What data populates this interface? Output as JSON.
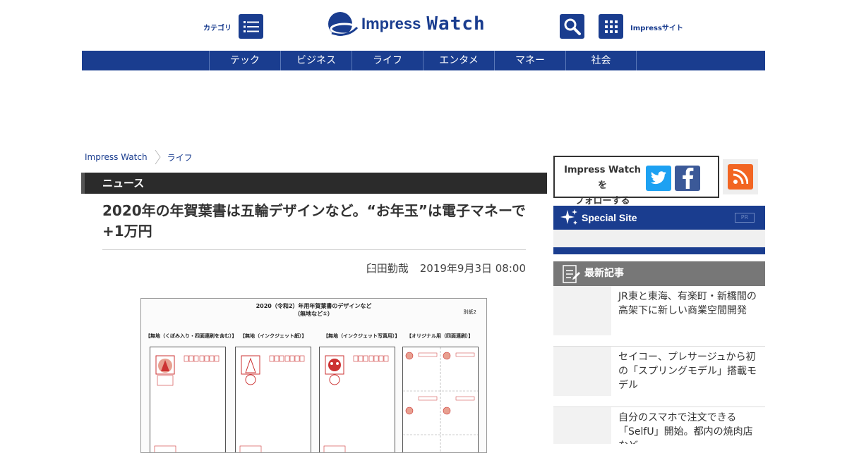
{
  "header": {
    "category_label": "カテゴリ",
    "logo_part1": "Impress",
    "logo_part2": "Watch",
    "impress_sites_label": "Impressサイト"
  },
  "nav": {
    "items": [
      "テック",
      "ビジネス",
      "ライフ",
      "エンタメ",
      "マネー",
      "社会"
    ]
  },
  "breadcrumb": {
    "items": [
      "Impress Watch",
      "ライフ"
    ]
  },
  "section": {
    "title": "ニュース"
  },
  "article": {
    "title": "2020年の年賀葉書は五輪デザインなど。“お年玉”は電子マネーで+1万円",
    "author": "臼田勤哉",
    "date": "2019年9月3日 08:00",
    "image": {
      "title_line1": "2020（令和2）年用年賀葉書のデザインなど",
      "title_line2": "（無地など①）",
      "tag": "別紙2",
      "card_labels": [
        "【無地（くぼみ入り・四面連刷を含む）】",
        "【無地（インクジェット紙）】",
        "【無地（インクジェット写真用）】",
        "【オリジナル用（四面連刷）】"
      ]
    }
  },
  "sidebar": {
    "follow_line1": "Impress Watch を",
    "follow_line2": "フォローする",
    "special_site_title": "Special Site",
    "pr_label": "PR",
    "latest_title": "最新記事",
    "latest_items": [
      "JR東と東海、有楽町・新橋間の高架下に新しい商業空間開発",
      "セイコー、プレサージュから初の「スプリングモデル」搭載モデル",
      "自分のスマホで注文できる「SelfU」開始。都内の焼肉店など"
    ]
  },
  "colors": {
    "brand_blue": "#1a3d8f",
    "twitter": "#1da1f2",
    "facebook": "#3b5998",
    "rss": "#f26522"
  }
}
